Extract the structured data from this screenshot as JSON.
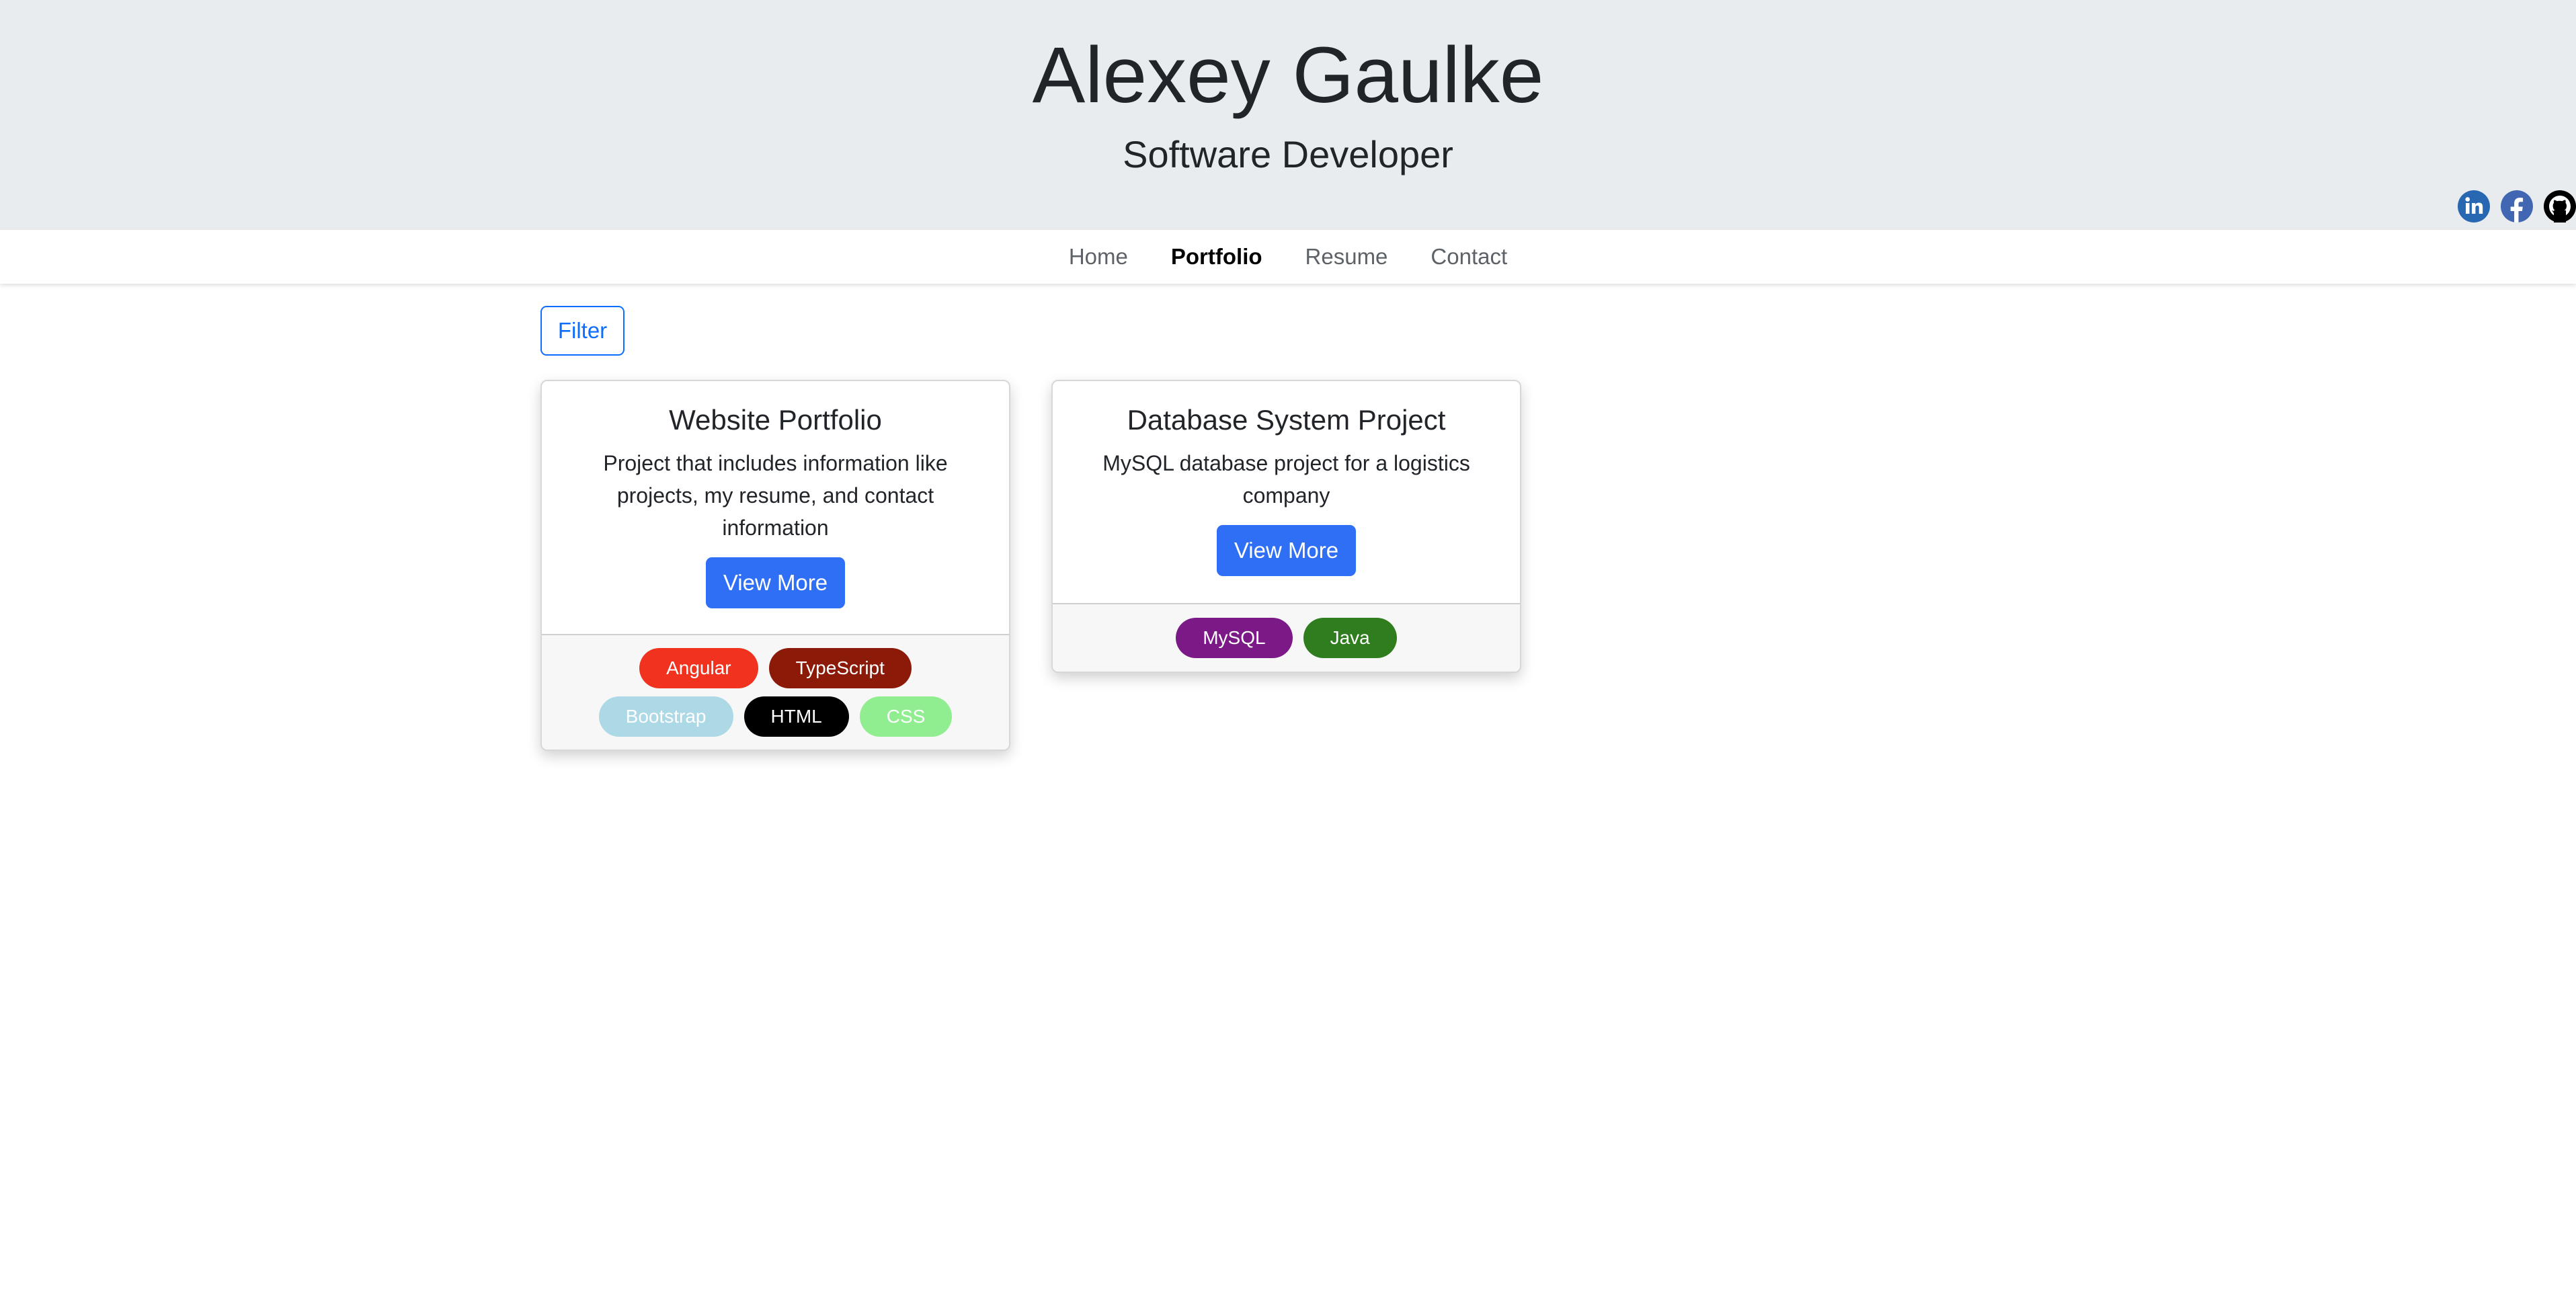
{
  "header": {
    "name": "Alexey Gaulke",
    "role": "Software Developer"
  },
  "social": [
    {
      "icon": "linkedin-icon",
      "color": "#2867b2"
    },
    {
      "icon": "facebook-icon",
      "color": "#4267b2"
    },
    {
      "icon": "github-icon",
      "color": "#000000"
    }
  ],
  "nav": {
    "items": [
      "Home",
      "Portfolio",
      "Resume",
      "Contact"
    ],
    "active": "Portfolio"
  },
  "filter": {
    "label": "Filter"
  },
  "projects": [
    {
      "title": "Website Portfolio",
      "description": "Project that includes information like projects, my resume, and contact information",
      "button": "View More",
      "tags": [
        {
          "label": "Angular",
          "bg": "#f0321e",
          "fg": "#ffffff"
        },
        {
          "label": "TypeScript",
          "bg": "#8b1a08",
          "fg": "#ffffff"
        },
        {
          "label": "Bootstrap",
          "bg": "#add8e6",
          "fg": "#ffffff"
        },
        {
          "label": "HTML",
          "bg": "#000000",
          "fg": "#ffffff"
        },
        {
          "label": "CSS",
          "bg": "#90ee90",
          "fg": "#ffffff"
        }
      ]
    },
    {
      "title": "Database System Project",
      "description": "MySQL database project for a logistics company",
      "button": "View More",
      "tags": [
        {
          "label": "MySQL",
          "bg": "#7b1a86",
          "fg": "#ffffff"
        },
        {
          "label": "Java",
          "bg": "#2f7d1e",
          "fg": "#ffffff"
        }
      ]
    }
  ],
  "colors": {
    "header_bg": "#e9ecef",
    "primary": "#0d6efd"
  }
}
